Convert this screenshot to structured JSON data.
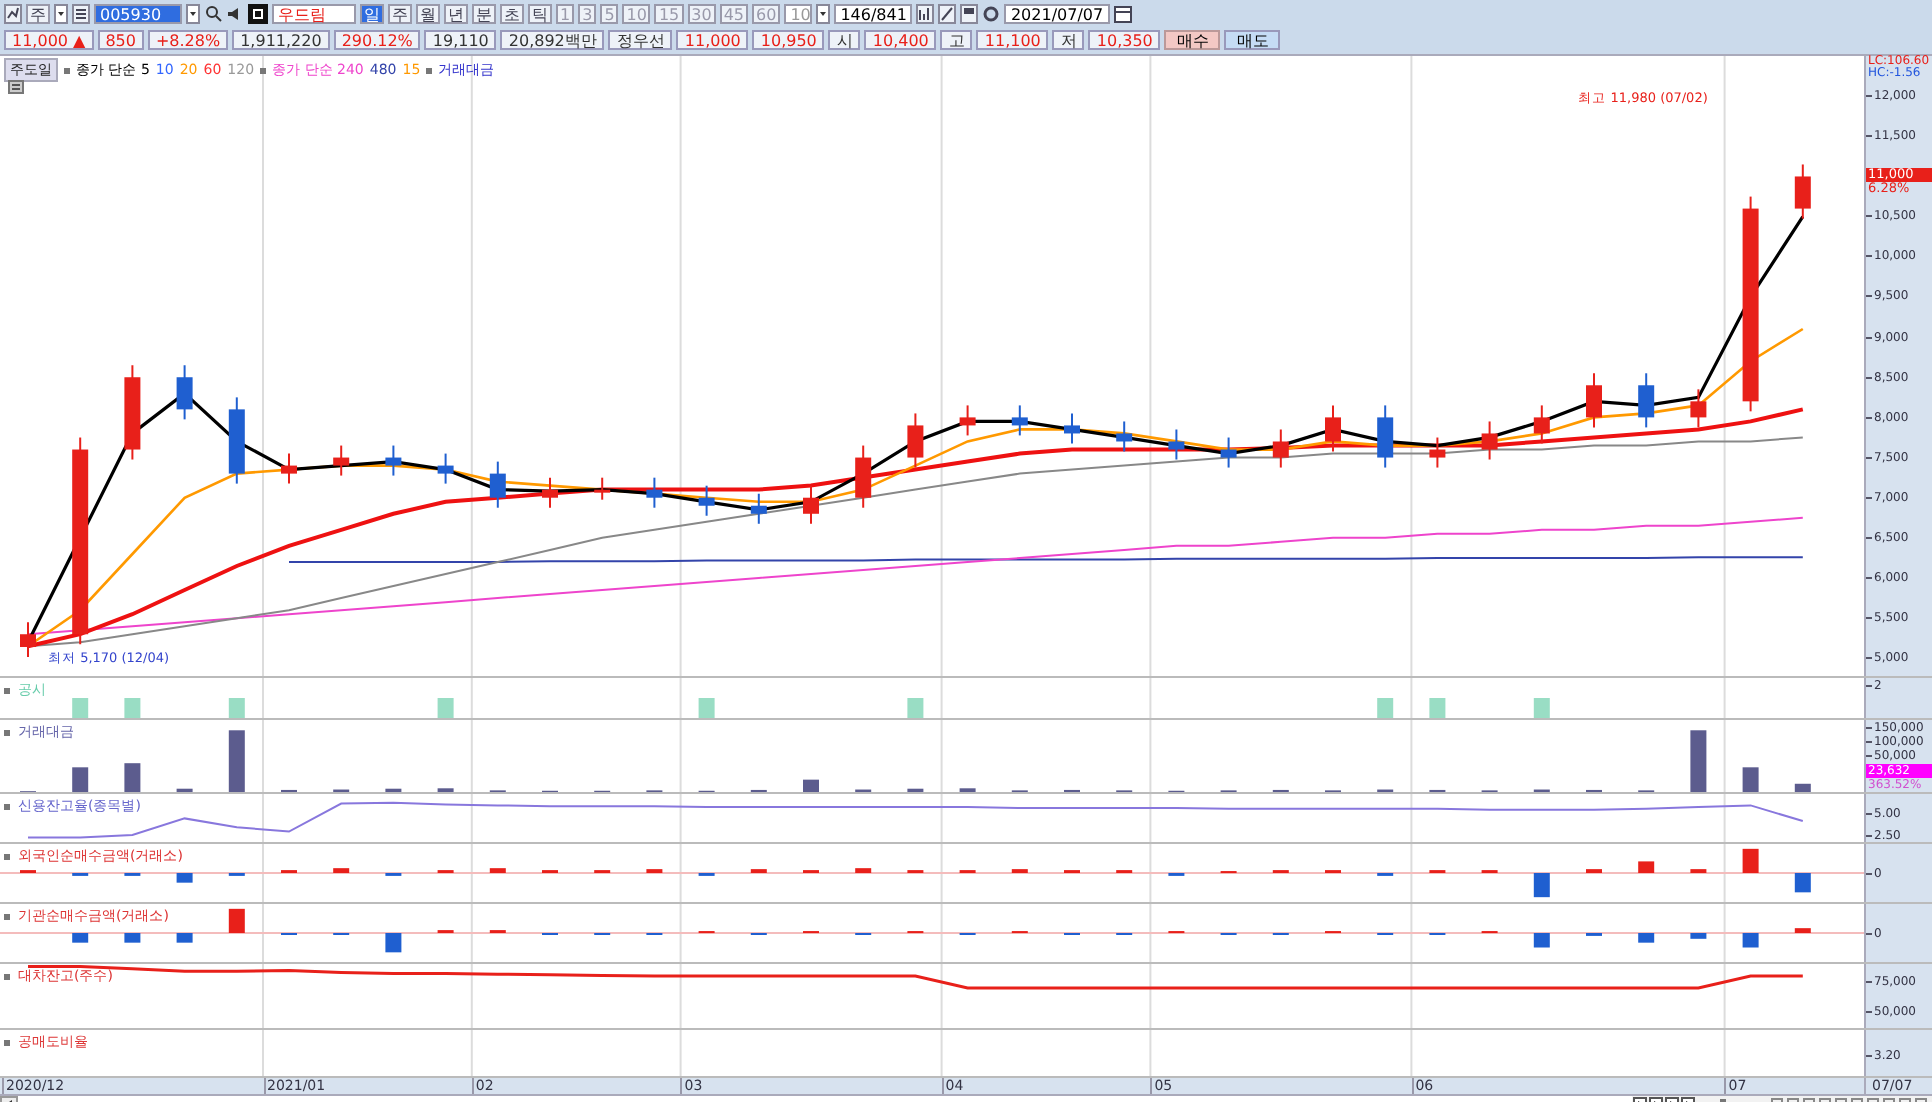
{
  "toolbar": {
    "market": "주",
    "code": "005930",
    "name": "우드림",
    "periods": [
      {
        "label": "일",
        "selected": true
      },
      {
        "label": "주",
        "selected": false
      },
      {
        "label": "월",
        "selected": false
      },
      {
        "label": "년",
        "selected": false
      },
      {
        "label": "분",
        "selected": false
      },
      {
        "label": "초",
        "selected": false
      },
      {
        "label": "틱",
        "selected": false
      }
    ],
    "intervals": [
      "1",
      "3",
      "5",
      "10",
      "15",
      "30",
      "45",
      "60"
    ],
    "count": "10",
    "range": "146/841",
    "date": "2021/07/07"
  },
  "quote": {
    "fields": [
      {
        "text": "11,000 ▲",
        "kind": "up"
      },
      {
        "text": "850",
        "kind": "up"
      },
      {
        "text": "+8.28%",
        "kind": "up"
      },
      {
        "text": "1,911,220",
        "kind": "plain"
      },
      {
        "text": "290.12%",
        "kind": "up"
      },
      {
        "text": "19,110",
        "kind": "plain"
      },
      {
        "text": "20,892백만",
        "kind": "plain"
      },
      {
        "text": "정우선",
        "kind": "plain"
      },
      {
        "text": "11,000",
        "kind": "up"
      },
      {
        "text": "10,950",
        "kind": "up"
      },
      {
        "text": "시",
        "kind": "plain"
      },
      {
        "text": "10,400",
        "kind": "up"
      },
      {
        "text": "고",
        "kind": "plain"
      },
      {
        "text": "11,100",
        "kind": "up"
      },
      {
        "text": "저",
        "kind": "plain"
      },
      {
        "text": "10,350",
        "kind": "up"
      }
    ],
    "buttons": [
      {
        "label": "매수",
        "kind": "buy"
      },
      {
        "label": "매도",
        "kind": "sell"
      }
    ]
  },
  "price_chart": {
    "legend": [
      {
        "label": "주도일"
      },
      {
        "label": "종가 단순 5",
        "color": "#000000"
      },
      {
        "label": "10",
        "color": "#3366ff"
      },
      {
        "label": "20",
        "color": "#ff9900"
      },
      {
        "label": "60",
        "color": "#ff3333"
      },
      {
        "label": "120",
        "color": "#999999"
      },
      {
        "label": "종가 단순 240",
        "color": "#ee44cc"
      },
      {
        "label": "480",
        "color": "#3344aa"
      },
      {
        "label": "15",
        "color": "#ff9900"
      },
      {
        "label": "거래대금",
        "color": "#3333cc"
      }
    ],
    "lc": "LC:106.60",
    "hc": "HC:-1.56",
    "annotation": "최고 11,980 (07/02)",
    "low_label": "최저 5,170 (12/04)",
    "price_tag": {
      "price": "11,000",
      "change": "6.28%"
    },
    "axis_labels": [
      "12,000",
      "11,500",
      "10,500",
      "10,000",
      "9,500",
      "9,000",
      "8,500",
      "8,000",
      "7,500",
      "7,000",
      "6,500",
      "6,000",
      "5,500",
      "5,000"
    ]
  },
  "panels": [
    {
      "title": "공시",
      "color": "#66ccaa",
      "axis_labels": [
        "2"
      ]
    },
    {
      "title": "거래대금",
      "color": "#6666aa",
      "axis_labels": [
        "150,000",
        "100,000",
        "50,000"
      ],
      "tag": {
        "value": "23,632",
        "change": "363.52%"
      }
    },
    {
      "title": "신용잔고율(종목별)",
      "color": "#6666cc",
      "axis_labels": [
        "5.00",
        "2.50"
      ]
    },
    {
      "title": "외국인순매수금액(거래소)",
      "color": "#dd3333",
      "axis_labels": [
        "0"
      ]
    },
    {
      "title": "기관순매수금액(거래소)",
      "color": "#dd3434",
      "axis_labels": [
        "0"
      ]
    },
    {
      "title": "대차잔고(주수)",
      "color": "#dd3535",
      "axis_labels": [
        "75,000",
        "50,000"
      ]
    },
    {
      "title": "공매도비율",
      "color": "#dd3636",
      "axis_labels": [
        "3.20"
      ]
    }
  ],
  "time_axis": {
    "labels": [
      "2020/12",
      "2021/01",
      "02",
      "03",
      "04",
      "05",
      "06",
      "07"
    ],
    "end_label": "07/07"
  }
}
